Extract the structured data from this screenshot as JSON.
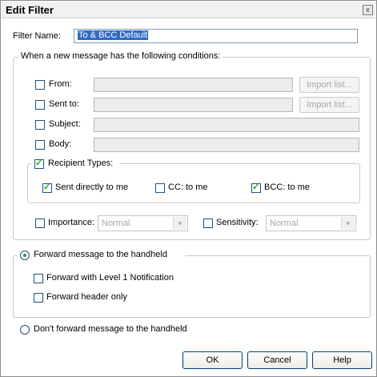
{
  "window": {
    "title": "Edit Filter",
    "close_glyph": "x"
  },
  "filter_name": {
    "label": "Filter Name:",
    "value": "To & BCC Default"
  },
  "conditions": {
    "legend": "When a new message has the following conditions:",
    "from": {
      "label": "From:",
      "checked": false,
      "value": "",
      "button": "Import list..."
    },
    "sent_to": {
      "label": "Sent to:",
      "checked": false,
      "value": "",
      "button": "Import list..."
    },
    "subject": {
      "label": "Subject:",
      "checked": false,
      "value": ""
    },
    "body": {
      "label": "Body:",
      "checked": false,
      "value": ""
    },
    "recipient_types": {
      "label": "Recipient Types:",
      "checked": true,
      "sent_directly": {
        "label": "Sent directly to me",
        "checked": true
      },
      "cc": {
        "label": "CC: to me",
        "checked": false
      },
      "bcc": {
        "label": "BCC: to me",
        "checked": true
      }
    },
    "importance": {
      "label": "Importance:",
      "checked": false,
      "value": "Normal"
    },
    "sensitivity": {
      "label": "Sensitivity:",
      "checked": false,
      "value": "Normal"
    }
  },
  "forward": {
    "label": "Forward message to the handheld",
    "selected": true,
    "level1": {
      "label": "Forward with Level 1 Notification",
      "checked": false
    },
    "header_only": {
      "label": "Forward header only",
      "checked": false
    }
  },
  "dont_forward": {
    "label": "Don't forward message to the handheld",
    "selected": false
  },
  "buttons": {
    "ok": "OK",
    "cancel": "Cancel",
    "help": "Help"
  }
}
